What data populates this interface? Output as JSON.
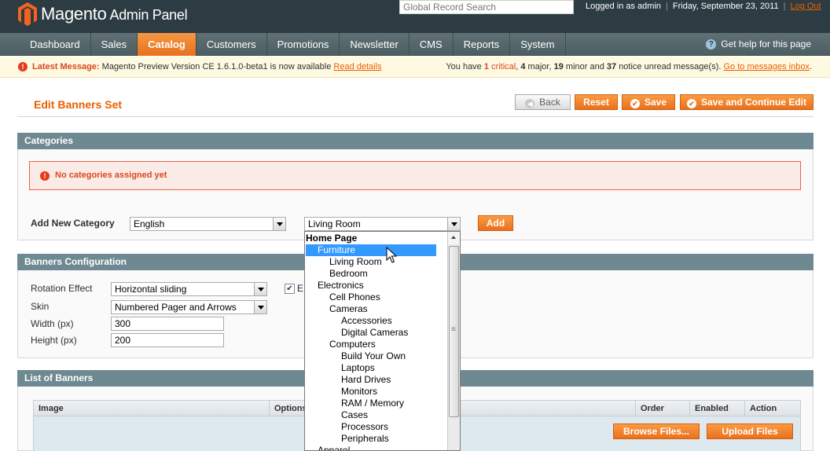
{
  "header": {
    "app_title": "Magento",
    "app_subtitle": "Admin Panel",
    "global_search_placeholder": "Global Record Search",
    "logged_in": "Logged in as admin",
    "date": "Friday, September 23, 2011",
    "logout": "Log Out"
  },
  "nav": {
    "items": [
      "Dashboard",
      "Sales",
      "Catalog",
      "Customers",
      "Promotions",
      "Newsletter",
      "CMS",
      "Reports",
      "System"
    ],
    "active": "Catalog",
    "help": "Get help for this page"
  },
  "messages": {
    "latest_label": "Latest Message:",
    "latest_text": "Magento Preview Version CE 1.6.1.0-beta1 is now available",
    "read_details": "Read details",
    "summary_prefix": "You have",
    "critical_count": "1",
    "critical_label": "critical",
    "major_count": "4",
    "major_label": "major",
    "minor_count": "19",
    "minor_label": "minor and",
    "notice_count": "37",
    "notice_label": "notice unread message(s).",
    "inbox_link": "Go to messages inbox"
  },
  "page": {
    "title": "Edit Banners Set",
    "buttons": {
      "back": "Back",
      "reset": "Reset",
      "save": "Save",
      "save_continue": "Save and Continue Edit"
    }
  },
  "categories": {
    "heading": "Categories",
    "error": "No categories assigned yet",
    "add_label": "Add New Category",
    "store_value": "English",
    "category_value": "Living Room",
    "add_button": "Add",
    "dropdown_items": [
      {
        "label": "Home Page",
        "level": 0,
        "bold": true
      },
      {
        "label": "Furniture",
        "level": 1,
        "selected": true
      },
      {
        "label": "Living Room",
        "level": 2
      },
      {
        "label": "Bedroom",
        "level": 2
      },
      {
        "label": "Electronics",
        "level": 1
      },
      {
        "label": "Cell Phones",
        "level": 2
      },
      {
        "label": "Cameras",
        "level": 2
      },
      {
        "label": "Accessories",
        "level": 3
      },
      {
        "label": "Digital Cameras",
        "level": 3
      },
      {
        "label": "Computers",
        "level": 2
      },
      {
        "label": "Build Your Own",
        "level": 3
      },
      {
        "label": "Laptops",
        "level": 3
      },
      {
        "label": "Hard Drives",
        "level": 3
      },
      {
        "label": "Monitors",
        "level": 3
      },
      {
        "label": "RAM / Memory",
        "level": 3
      },
      {
        "label": "Cases",
        "level": 3
      },
      {
        "label": "Processors",
        "level": 3
      },
      {
        "label": "Peripherals",
        "level": 3
      },
      {
        "label": "Apparel",
        "level": 1
      }
    ]
  },
  "banners_config": {
    "heading": "Banners Configuration",
    "rotation_label": "Rotation Effect",
    "rotation_value": "Horizontal sliding",
    "skin_label": "Skin",
    "skin_value": "Numbered Pager and Arrows",
    "width_label": "Width (px)",
    "width_value": "300",
    "height_label": "Height (px)",
    "height_value": "200",
    "checkbox_label_fragment": "E"
  },
  "list_of_banners": {
    "heading": "List of Banners",
    "columns": [
      "Image",
      "Options",
      "Order",
      "Enabled",
      "Action"
    ],
    "browse_button": "Browse Files...",
    "upload_button": "Upload Files"
  },
  "colors": {
    "accent": "#eb5e00",
    "header_bg": "#2d3c43",
    "section_head": "#6f8992",
    "selection": "#3399ff"
  }
}
